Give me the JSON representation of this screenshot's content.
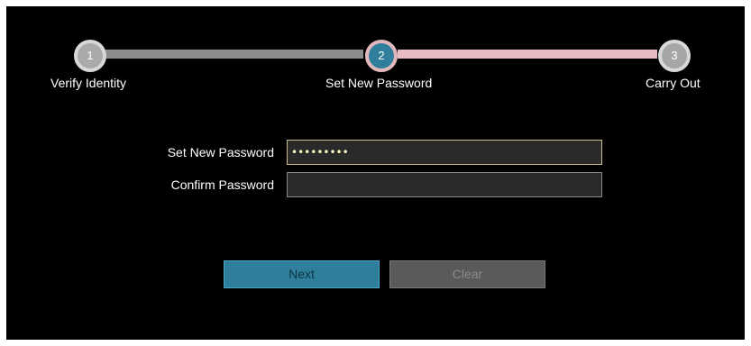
{
  "stepper": {
    "steps": [
      {
        "number": "1",
        "label": "Verify Identity",
        "state": "done"
      },
      {
        "number": "2",
        "label": "Set New Password",
        "state": "active"
      },
      {
        "number": "3",
        "label": "Carry Out",
        "state": "upcoming"
      }
    ]
  },
  "form": {
    "new_password": {
      "label": "Set New Password",
      "value": "•••••••••"
    },
    "confirm_password": {
      "label": "Confirm Password",
      "value": ""
    }
  },
  "buttons": {
    "next_label": "Next",
    "clear_label": "Clear"
  },
  "colors": {
    "background": "#000000",
    "page": "#ffffff",
    "done_circle_fill": "#aaaaaa",
    "done_circle_ring": "#d8d8d8",
    "done_bar": "#8c8c8c",
    "active_circle_fill": "#2f7f9c",
    "active_circle_ring": "#e2b8bd",
    "upcoming_bar": "#e6bcc1",
    "upcoming_circle_fill": "#a6a6a6",
    "upcoming_circle_ring": "#d8d8d8",
    "active_field_border": "#c9bf8e",
    "field_border": "#8a8a8a",
    "next_button": "#2f7f9c",
    "clear_button": "#5a5a5a"
  }
}
